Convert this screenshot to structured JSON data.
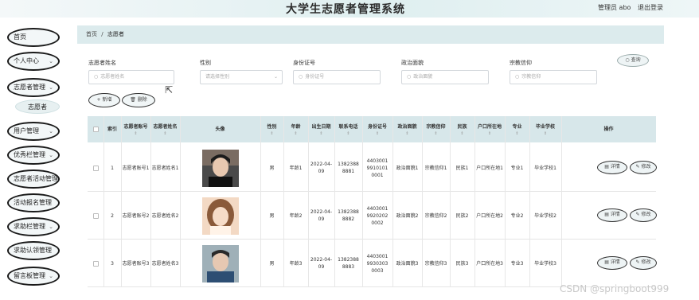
{
  "header": {
    "title": "大学生志愿者管理系统",
    "user": "管理员 abo",
    "logout": "退出登录"
  },
  "sidebar": {
    "items": [
      {
        "label": "首页",
        "chevron": false
      },
      {
        "label": "个人中心",
        "chevron": true
      },
      {
        "label": "志愿者管理",
        "chevron": true
      },
      {
        "label": "用户管理",
        "chevron": true
      },
      {
        "label": "优秀栏管理",
        "chevron": true
      },
      {
        "label": "志愿者活动管理",
        "chevron": false
      },
      {
        "label": "活动报名管理",
        "chevron": false
      },
      {
        "label": "求助栏管理",
        "chevron": true
      },
      {
        "label": "求助认领管理",
        "chevron": false
      },
      {
        "label": "留言板管理",
        "chevron": true
      }
    ],
    "subitem": "志愿者"
  },
  "breadcrumb": {
    "home": "首页",
    "sep": "/",
    "current": "志愿者"
  },
  "search": {
    "fields": [
      {
        "label": "志愿者姓名",
        "placeholder": "志愿者姓名",
        "type": "text"
      },
      {
        "label": "性别",
        "placeholder": "请选择性别",
        "type": "select"
      },
      {
        "label": "身份证号",
        "placeholder": "身份证号",
        "type": "text"
      },
      {
        "label": "政治面貌",
        "placeholder": "政治面貌",
        "type": "text"
      },
      {
        "label": "宗教信仰",
        "placeholder": "宗教信仰",
        "type": "text"
      }
    ],
    "query": "查询"
  },
  "actions": {
    "add": "+ 新增",
    "delete": "删除"
  },
  "table": {
    "columns": [
      "",
      "索引",
      "志愿者账号",
      "志愿者姓名",
      "头像",
      "性别",
      "年龄",
      "出生日期",
      "联系电话",
      "身份证号",
      "政治面貌",
      "宗教信仰",
      "民族",
      "户口所在地",
      "专业",
      "毕业学校",
      "操作"
    ],
    "rows": [
      {
        "index": "1",
        "account": "志愿者账号1",
        "name": "志愿者姓名1",
        "gender": "男",
        "age": "年龄1",
        "birth": "2022-04-09",
        "phone": "13823888881",
        "id": "440300199101010001",
        "politics": "政治面貌1",
        "religion": "宗教信仰1",
        "ethnic": "民族1",
        "hukou": "户口所在地1",
        "major": "专业1",
        "school": "毕业学校1"
      },
      {
        "index": "2",
        "account": "志愿者账号2",
        "name": "志愿者姓名2",
        "gender": "男",
        "age": "年龄2",
        "birth": "2022-04-09",
        "phone": "13823888882",
        "id": "440300199202020002",
        "politics": "政治面貌2",
        "religion": "宗教信仰2",
        "ethnic": "民族2",
        "hukou": "户口所在地2",
        "major": "专业2",
        "school": "毕业学校2"
      },
      {
        "index": "3",
        "account": "志愿者账号3",
        "name": "志愿者姓名3",
        "gender": "男",
        "age": "年龄3",
        "birth": "2022-04-09",
        "phone": "13823888883",
        "id": "440300199303030003",
        "politics": "政治面貌3",
        "religion": "宗教信仰3",
        "ethnic": "民族3",
        "hukou": "户口所在地3",
        "major": "专业3",
        "school": "毕业学校3"
      }
    ],
    "detail": "详情",
    "edit": "修改"
  },
  "watermark": "CSDN @springboot999",
  "colors": {
    "accent": "#dcebed",
    "header_bg": "#d7e7ea"
  }
}
